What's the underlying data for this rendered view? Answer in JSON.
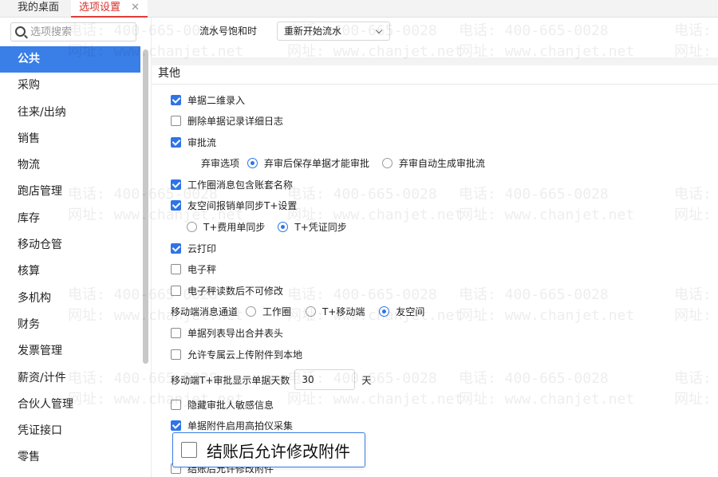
{
  "tabs": [
    {
      "label": "我的桌面"
    },
    {
      "label": "选项设置",
      "close": "✕"
    }
  ],
  "search": {
    "placeholder": "选项搜索"
  },
  "sidebar": {
    "items": [
      "公共",
      "采购",
      "往来/出纳",
      "销售",
      "物流",
      "跑店管理",
      "库存",
      "移动仓管",
      "核算",
      "多机构",
      "财务",
      "发票管理",
      "薪资/计件",
      "合伙人管理",
      "凭证接口",
      "零售"
    ],
    "active_index": 0
  },
  "serial": {
    "label": "流水号饱和时",
    "value": "重新开始流水"
  },
  "section": {
    "title": "其他"
  },
  "options": {
    "qr_input": "单据二维录入",
    "delete_log": "删除单据记录详细日志",
    "approval_flow": "审批流",
    "abandon_label": "弃审选项",
    "abandon_opt1": "弃审后保存单据才能审批",
    "abandon_opt2": "弃审自动生成审批流",
    "workcircle_account": "工作圈消息包含账套名称",
    "friend_space_sync": "友空间报销单同步T+设置",
    "sync_opt1": "T+费用单同步",
    "sync_opt2": "T+凭证同步",
    "cloud_print": "云打印",
    "scale": "电子秤",
    "scale_readonly": "电子秤读数后不可修改",
    "mobile_channel_label": "移动端消息通道",
    "channel_opt1": "工作圈",
    "channel_opt2": "T+移动端",
    "channel_opt3": "友空间",
    "export_merge": "单据列表导出合并表头",
    "private_cloud_upload": "允许专属云上传附件到本地",
    "mobile_days_label": "移动端T+审批显示单据天数",
    "mobile_days_value": "30",
    "mobile_days_unit": "天",
    "hide_approver": "隐藏审批人敏感信息",
    "high_camera": "单据附件启用高拍仪采集",
    "allow_modify_after_close": "结账后允许修改附件"
  },
  "popup": {
    "label": "结账后允许修改附件"
  },
  "watermark": {
    "phone": "电话: 400-665-0028",
    "site": "网址: www.chanjet.net"
  },
  "colors": {
    "accent": "#3a7ee8",
    "tab_active": "#d9302b"
  }
}
